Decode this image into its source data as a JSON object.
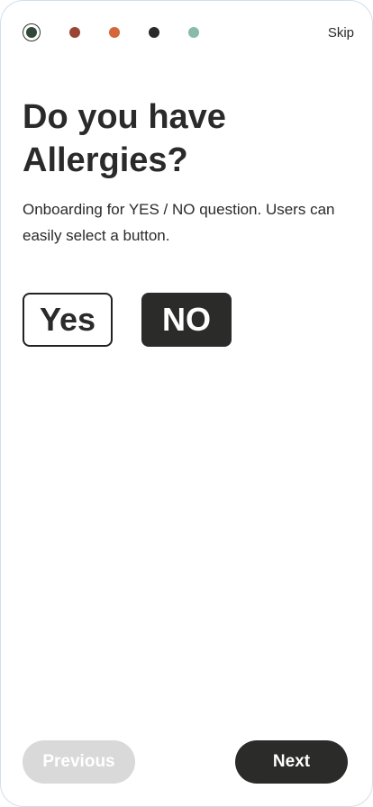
{
  "progress": {
    "steps": [
      {
        "name": "step-1",
        "color": "#34473b",
        "active": true
      },
      {
        "name": "step-2",
        "color": "#9a4434",
        "active": false
      },
      {
        "name": "step-3",
        "color": "#d4663a",
        "active": false
      },
      {
        "name": "step-4",
        "color": "#2a2a2a",
        "active": false
      },
      {
        "name": "step-5",
        "color": "#88bba9",
        "active": false
      }
    ]
  },
  "header": {
    "skip_label": "Skip"
  },
  "main": {
    "title": "Do you have Allergies?",
    "subtitle": "Onboarding for YES / NO question. Users can easily select a button.",
    "options": {
      "yes_label": "Yes",
      "no_label": "NO",
      "selected": "NO"
    }
  },
  "footer": {
    "previous_label": "Previous",
    "next_label": "Next"
  },
  "colors": {
    "primary": "#2b2c2a",
    "disabled": "#d9d9d9",
    "text": "#2a2a2a"
  }
}
